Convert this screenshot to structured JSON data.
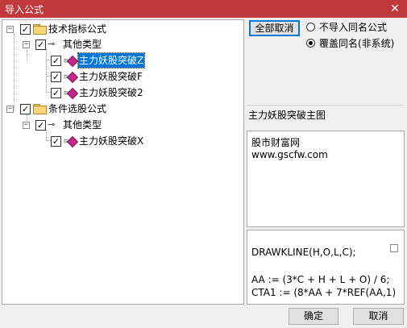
{
  "window": {
    "title": "导入公式",
    "close_glyph": "✕"
  },
  "tree": {
    "groups": [
      {
        "label": "技术指标公式",
        "subgroup": "其他类型",
        "items": [
          "主力妖股突破Z",
          "主力妖股突破F",
          "主力妖股突破2"
        ]
      },
      {
        "label": "条件选股公式",
        "subgroup": "其他类型",
        "items": [
          "主力妖股突破X"
        ]
      }
    ],
    "selected": "主力妖股突破Z"
  },
  "options": {
    "cancel_all_label": "全部取消",
    "radio_no_import": "不导入同名公式",
    "radio_overwrite": "覆盖同名(非系统)",
    "selected_option": "overwrite"
  },
  "detail": {
    "formula_name": "主力妖股突破主图",
    "source_line1": "股市财富网",
    "source_line2": "www.gscfw.com",
    "code_lines": [
      "DRAWKLINE(H,O,L,C);",
      "",
      "AA := (3*C + H + L + O) / 6;",
      "CTA1 := (8*AA + 7*REF(AA,1)"
    ]
  },
  "footer": {
    "ok_label": "确定",
    "cancel_label": "取消"
  }
}
